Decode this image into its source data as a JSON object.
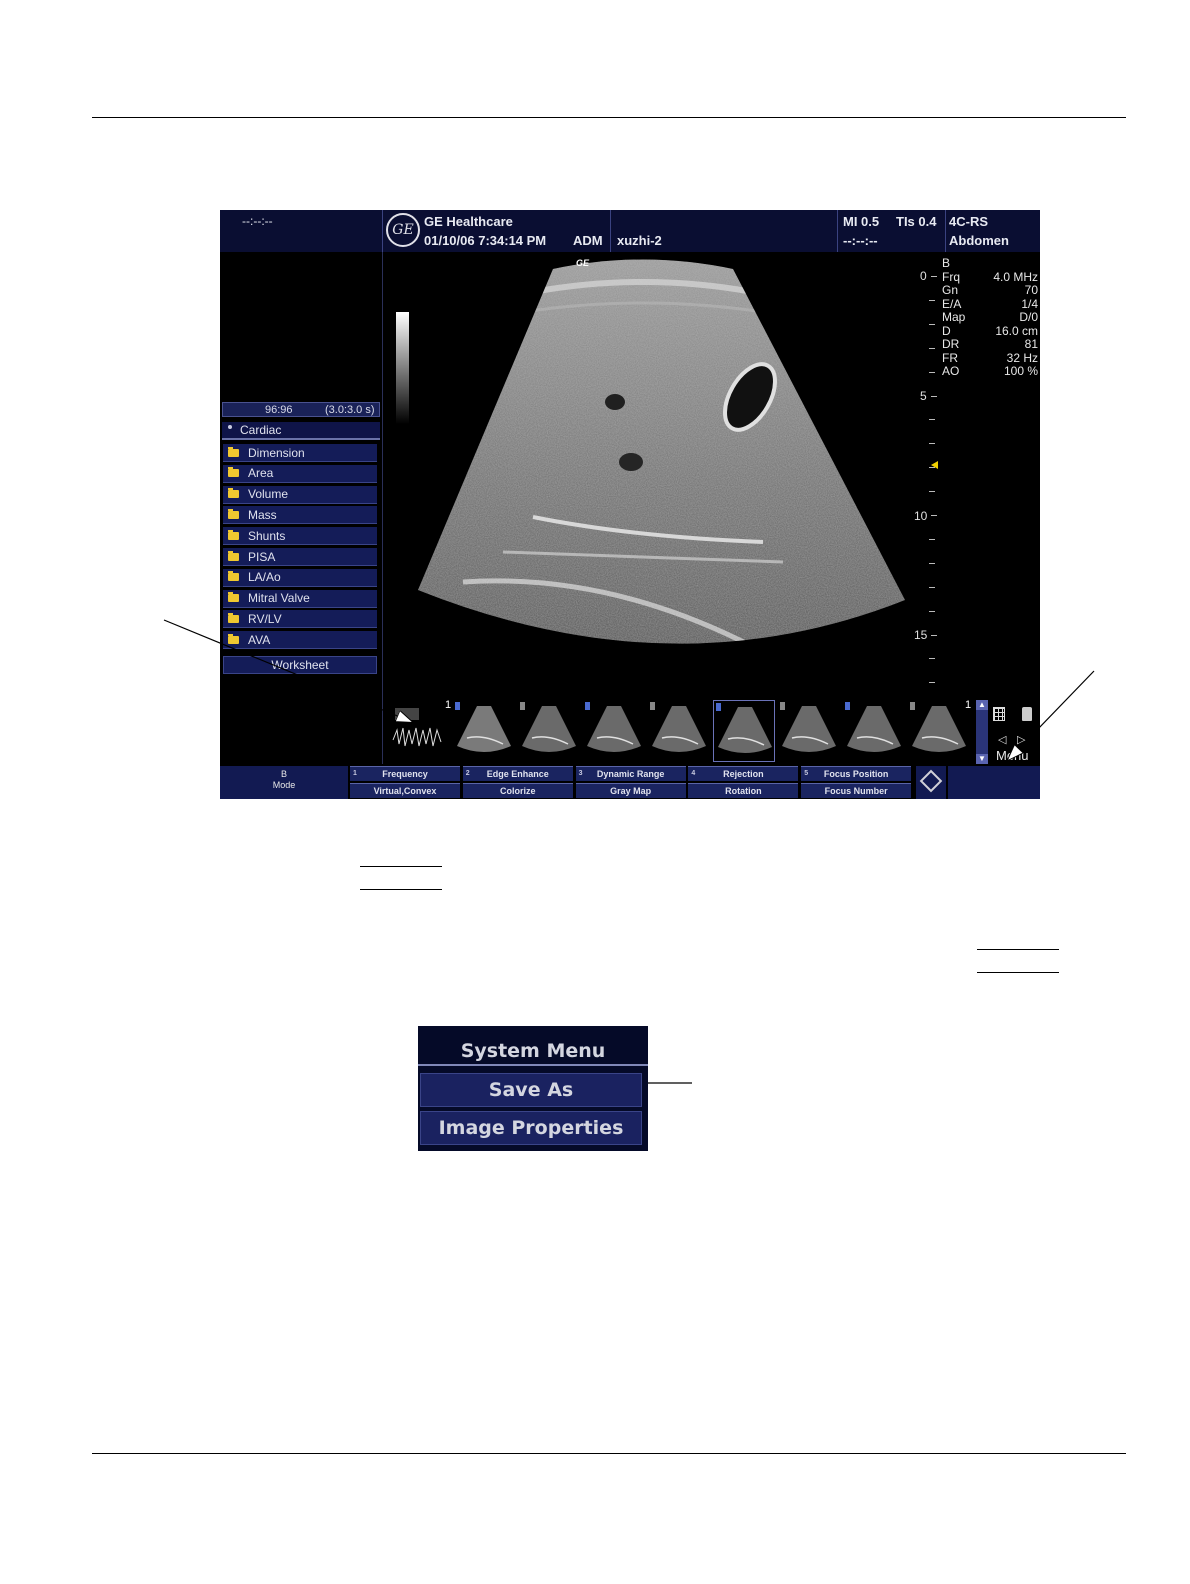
{
  "screen": {
    "top_left_status": "--:--:--",
    "brand": "GE Healthcare",
    "logo_text": "GE",
    "datetime": "01/10/06 7:34:14 PM",
    "operator": "ADM",
    "patient": "xuzhi-2",
    "mi": "MI 0.5",
    "tis": "TIs 0.4",
    "probe": "4C-RS",
    "status_dashes": "--:--:--",
    "application": "Abdomen",
    "image_watermark": "GE",
    "params": [
      {
        "k": "B",
        "v": ""
      },
      {
        "k": "Frq",
        "v": "4.0 MHz"
      },
      {
        "k": "Gn",
        "v": "70"
      },
      {
        "k": "E/A",
        "v": "1/4"
      },
      {
        "k": "Map",
        "v": "D/0"
      },
      {
        "k": "D",
        "v": "16.0 cm"
      },
      {
        "k": "DR",
        "v": "81"
      },
      {
        "k": "FR",
        "v": "32 Hz"
      },
      {
        "k": "AO",
        "v": "100 %"
      }
    ],
    "depth_labels": [
      "0",
      "5",
      "10",
      "15"
    ],
    "timer": {
      "frames": "96:96",
      "duration": "(3.0:3.0 s)"
    },
    "measure_package": "Cardiac",
    "measure_items": [
      "Dimension",
      "Area",
      "Volume",
      "Mass",
      "Shunts",
      "PISA",
      "LA/Ao",
      "Mitral Valve",
      "RV/LV",
      "AVA"
    ],
    "worksheet_label": "Worksheet",
    "thumb_number_left": "1",
    "thumb_number_right": "1",
    "menu_label": "Menu",
    "mode": {
      "line1": "B",
      "line2": "Mode"
    },
    "softkeys_top": [
      {
        "n": "1",
        "label": "Frequency"
      },
      {
        "n": "2",
        "label": "Edge Enhance"
      },
      {
        "n": "3",
        "label": "Dynamic Range"
      },
      {
        "n": "4",
        "label": "Rejection"
      },
      {
        "n": "5",
        "label": "Focus Position"
      }
    ],
    "softkeys_bottom": [
      {
        "label": "Virtual,Convex"
      },
      {
        "label": "Colorize"
      },
      {
        "label": "Gray Map"
      },
      {
        "label": "Rotation"
      },
      {
        "label": "Focus Number"
      }
    ]
  },
  "system_menu": {
    "title": "System Menu",
    "items": [
      "Save As",
      "Image Properties"
    ]
  }
}
